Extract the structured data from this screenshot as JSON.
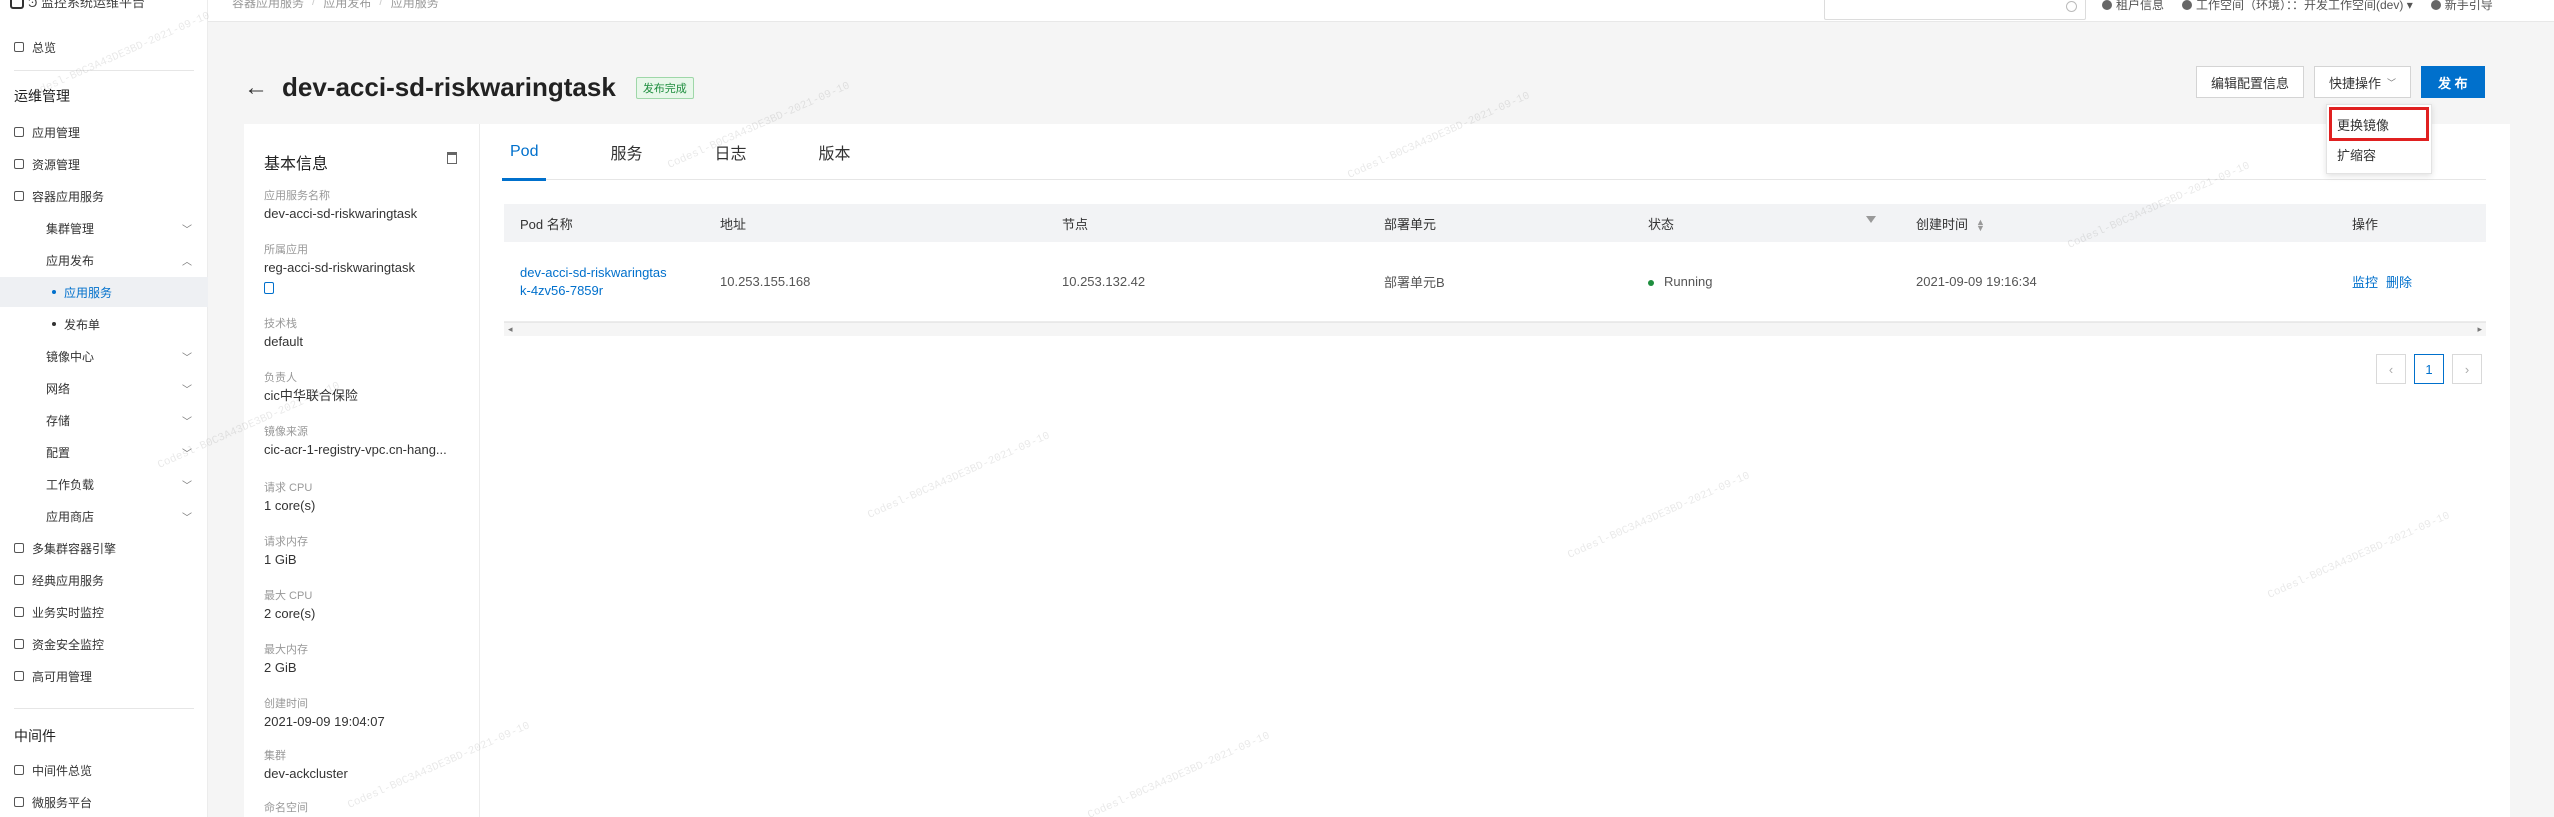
{
  "breadcrumb": [
    "容器应用服务",
    "应用发布",
    "应用服务"
  ],
  "topbar": {
    "items": [
      "租户信息",
      "工作空间（环境）：：开发工作空间(dev) ▾",
      "新手引导"
    ]
  },
  "sidebar": {
    "logo": "Ͽ 监控系统运维平台",
    "items": [
      {
        "label": "总览",
        "level": 0
      },
      {
        "label": "应用管理",
        "level": 0
      },
      {
        "label": "资源管理",
        "level": 0
      },
      {
        "label": "容器应用服务",
        "level": 0
      },
      {
        "label": "集群管理",
        "level": 1,
        "chevron": "﹀"
      },
      {
        "label": "应用发布",
        "level": 1,
        "chevron": "︿"
      },
      {
        "label": "应用服务",
        "level": 2
      },
      {
        "label": "发布单",
        "level": 2
      },
      {
        "label": "镜像中心",
        "level": 1,
        "chevron": "﹀"
      },
      {
        "label": "网络",
        "level": 1,
        "chevron": "﹀"
      },
      {
        "label": "存储",
        "level": 1,
        "chevron": "﹀"
      },
      {
        "label": "配置",
        "level": 1,
        "chevron": "﹀"
      },
      {
        "label": "工作负载",
        "level": 1,
        "chevron": "﹀"
      },
      {
        "label": "应用商店",
        "level": 1,
        "chevron": "﹀"
      },
      {
        "label": "多集群容器引擎",
        "level": 0
      },
      {
        "label": "经典应用服务",
        "level": 0
      },
      {
        "label": "业务实时监控",
        "level": 0
      },
      {
        "label": "资金安全监控",
        "level": 0
      },
      {
        "label": "高可用管理",
        "level": 0
      },
      {
        "label": "中间件总览",
        "level": 0
      },
      {
        "label": "微服务平台",
        "level": 0
      }
    ],
    "sections": [
      "运维管理",
      "中间件"
    ]
  },
  "header": {
    "back": "←",
    "title": "dev-acci-sd-riskwaringtask",
    "status": "发布完成",
    "actions": {
      "edit": "编辑配置信息",
      "quick": "快捷操作",
      "quick_chevron": "﹀",
      "publish": "发 布"
    }
  },
  "dropdown": {
    "items": [
      "更换镜像",
      "扩缩容"
    ]
  },
  "info": {
    "title": "基本信息",
    "fields": [
      {
        "label": "应用服务名称",
        "value": "dev-acci-sd-riskwaringtask"
      },
      {
        "label": "所属应用",
        "value": "reg-acci-sd-riskwaringtask"
      },
      {
        "label": "技术栈",
        "value": "default"
      },
      {
        "label": "负责人",
        "value": "cic中华联合保险"
      },
      {
        "label": "镜像来源",
        "value": "cic-acr-1-registry-vpc.cn-hang..."
      },
      {
        "label": "请求 CPU",
        "value": "1 core(s)"
      },
      {
        "label": "请求内存",
        "value": "1 GiB"
      },
      {
        "label": "最大 CPU",
        "value": "2 core(s)"
      },
      {
        "label": "最大内存",
        "value": "2 GiB"
      },
      {
        "label": "创建时间",
        "value": "2021-09-09 19:04:07"
      },
      {
        "label": "集群",
        "value": "dev-ackcluster"
      },
      {
        "label": "命名空间",
        "value": ""
      }
    ]
  },
  "tabs": [
    {
      "label": "Pod",
      "active": true
    },
    {
      "label": "服务",
      "active": false
    },
    {
      "label": "日志",
      "active": false
    },
    {
      "label": "版本",
      "active": false
    }
  ],
  "table": {
    "headers": [
      "Pod 名称",
      "地址",
      "节点",
      "部署单元",
      "状态",
      "创建时间",
      "操作"
    ],
    "rows": [
      {
        "pod": "dev-acci-sd-riskwaringtask-4zv56-7859r",
        "address": "10.253.155.168",
        "node": "10.253.132.42",
        "unit": "部署单元B",
        "status": "Running",
        "created": "2021-09-09 19:16:34",
        "ops": [
          "监控",
          "删除"
        ]
      }
    ]
  },
  "pager": {
    "prev": "‹",
    "current": "1",
    "next": "›"
  },
  "watermark": "Codesl-B0C3A43DE3BD-2021-09-10",
  "colors": {
    "accent": "#0070cc",
    "success": "#1e8e3e",
    "highlight_box": "#e02020"
  }
}
